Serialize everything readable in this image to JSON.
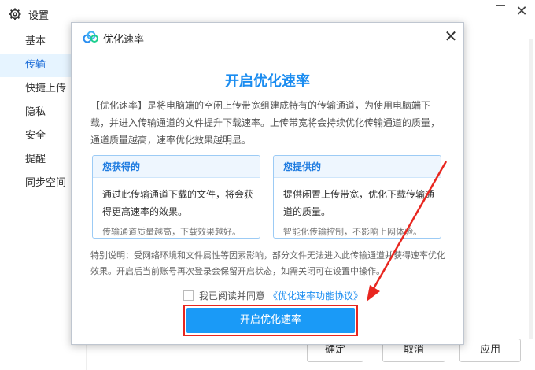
{
  "window": {
    "title": "设置",
    "close_glyph": "✕"
  },
  "sidebar": {
    "items": [
      {
        "label": "基本",
        "active": false
      },
      {
        "label": "传输",
        "active": true
      },
      {
        "label": "快捷上传",
        "active": false
      },
      {
        "label": "隐私",
        "active": false
      },
      {
        "label": "安全",
        "active": false
      },
      {
        "label": "提醒",
        "active": false
      },
      {
        "label": "同步空间",
        "active": false
      }
    ]
  },
  "footer": {
    "ok_label": "确定",
    "cancel_label": "取消",
    "apply_label": "应用"
  },
  "modal": {
    "title": "优化速率",
    "close_glyph": "✕",
    "heading": "开启优化速率",
    "description": "【优化速率】是将电脑端的空闲上传带宽组建成特有的传输通道，为使用电脑端下载，并进入传输通道的文件提升下载速率。上传带宽将会持续优化传输通道的质量，通道质量越高，速率优化效果越明显。",
    "card_get": {
      "title": "您获得的",
      "body": "通过此传输通道下载的文件，将会获得更高速率的效果。",
      "note": "传输通道质量越高，下载效果越好。"
    },
    "card_give": {
      "title": "您提供的",
      "body": "提供闲置上传带宽，优化下载传输通道的质量。",
      "note": "智能化传输控制，不影响上网体验。"
    },
    "special_note": "特别说明：受网络环境和文件属性等因素影响，部分文件无法进入此传输通道并获得速率优化效果。开启后当前账号再次登录会保留开启状态，如需关闭可在设置中操作。",
    "agree_label": "我已阅读并同意",
    "agree_link": "《优化速率功能协议》",
    "agree_checked": false,
    "enable_button": "开启优化速率"
  },
  "colors": {
    "accent": "#1a8cf0",
    "button": "#1a9af7",
    "highlight": "#e8261f",
    "sidebar_active_bg": "#e6f4ff"
  }
}
